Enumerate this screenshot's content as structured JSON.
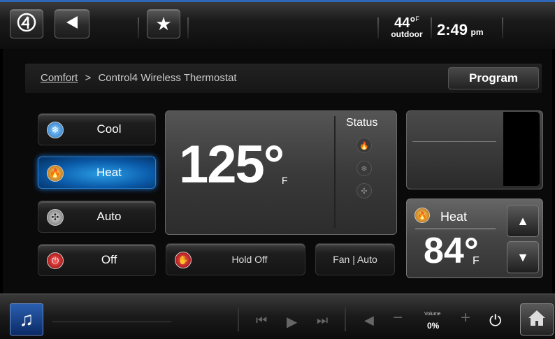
{
  "topbar": {
    "logo_icon": "control4-logo-icon",
    "back_icon": "back-arrow-icon",
    "favorite_icon": "star-icon",
    "outdoor_temp": "44°",
    "outdoor_unit": "F",
    "outdoor_label": "outdoor",
    "time": "2:49",
    "ampm": "pm"
  },
  "breadcrumb": {
    "root": "Comfort",
    "separator": ">",
    "current": "Control4 Wireless Thermostat"
  },
  "program_label": "Program",
  "modes": [
    {
      "label": "Cool",
      "icon": "snowflake-icon"
    },
    {
      "label": "Heat",
      "icon": "flame-icon",
      "active": true
    },
    {
      "label": "Auto",
      "icon": "fan-icon"
    },
    {
      "label": "Off",
      "icon": "power-icon"
    }
  ],
  "current_temp": {
    "value": "125°",
    "unit": "F"
  },
  "status": {
    "title": "Status",
    "icons": [
      "flame-icon",
      "snowflake-icon",
      "fan-icon"
    ]
  },
  "hold_label": "Hold Off",
  "fan_label": "Fan | Auto",
  "setpoint": {
    "mode": "Heat",
    "value": "84°",
    "unit": "F"
  },
  "bottombar": {
    "music_icon": "music-note-icon",
    "volume_label": "Volume",
    "volume_value": "0%",
    "accent": "#2f67b8"
  }
}
